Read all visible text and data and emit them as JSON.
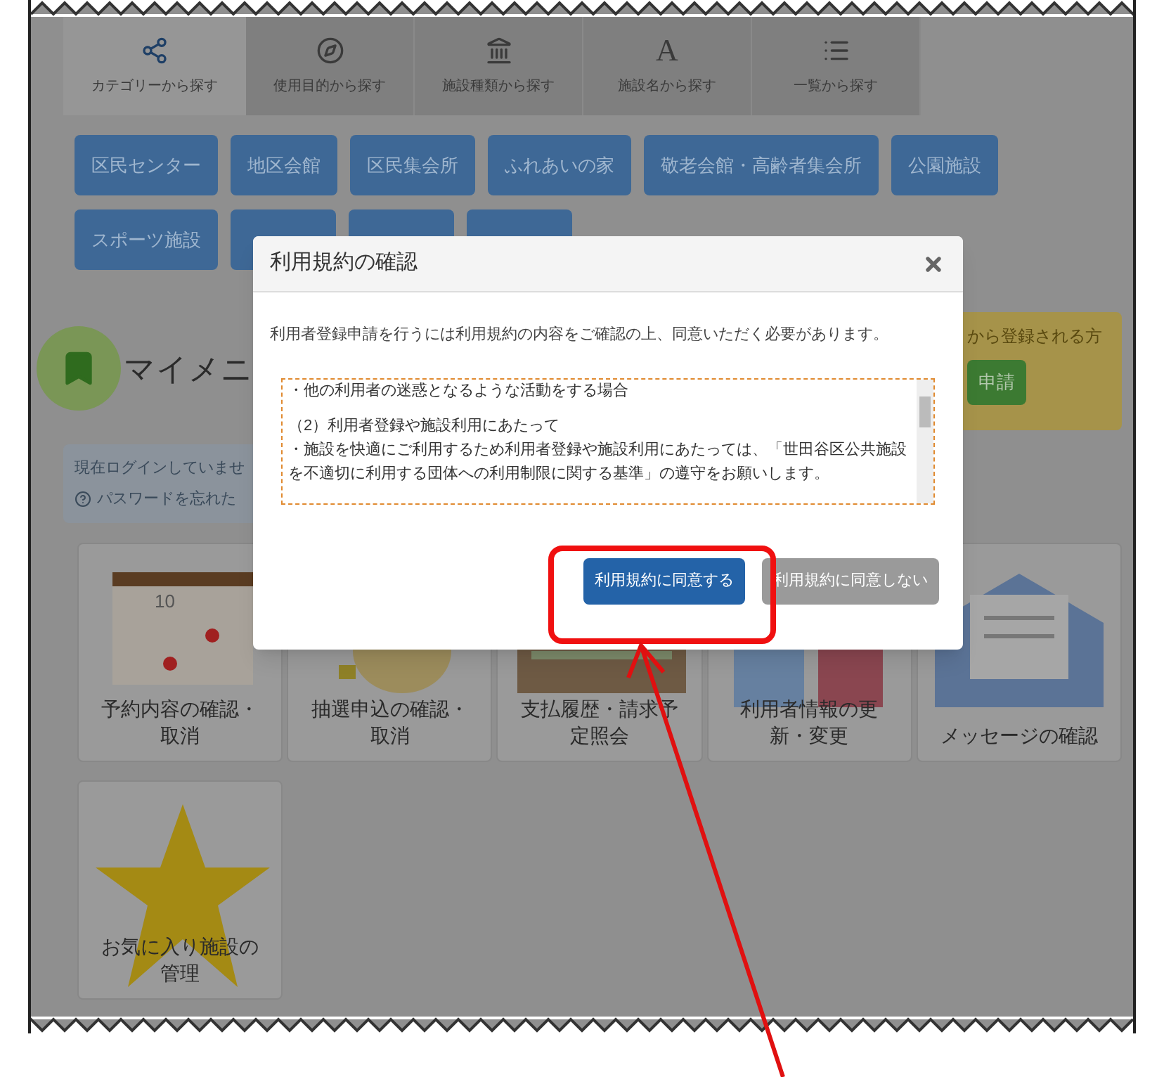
{
  "tabs": [
    {
      "label": "カテゴリーから探す",
      "kind": "share",
      "selected": true
    },
    {
      "label": "使用目的から探す",
      "kind": "compass",
      "selected": false
    },
    {
      "label": "施設種類から探す",
      "kind": "bank",
      "selected": false
    },
    {
      "label": "施設名から探す",
      "kind": "letter",
      "glyph": "A",
      "selected": false
    },
    {
      "label": "一覧から探す",
      "kind": "list",
      "selected": false
    }
  ],
  "categories": [
    {
      "kind": "text",
      "label": "区民センター"
    },
    {
      "kind": "text",
      "label": "地区会館"
    },
    {
      "kind": "text",
      "label": "区民集会所"
    },
    {
      "kind": "text",
      "label": "ふれあいの家"
    },
    {
      "kind": "text",
      "label": "敬老会館・高齢者集会所"
    },
    {
      "kind": "text",
      "label": "公園施設"
    },
    {
      "kind": "text",
      "label": "スポーツ施設"
    },
    {
      "kind": "covered"
    },
    {
      "kind": "covered"
    },
    {
      "kind": "covered"
    }
  ],
  "my_menu": {
    "title": "マイメニ",
    "login_text": "現在ログインしていませ",
    "forgot_link": "パスワードを忘れた"
  },
  "register_box": {
    "text": "から登録される方",
    "button": "申請"
  },
  "tiles": [
    {
      "label": "予約内容の確認・取消",
      "kind": "calendar",
      "art_text": "10"
    },
    {
      "label": "抽選申込の確認・取消",
      "kind": "lottery"
    },
    {
      "label": "支払履歴・請求予定照会",
      "kind": "payment"
    },
    {
      "label": "利用者情報の更新・変更",
      "kind": "people"
    },
    {
      "label": "メッセージの確認",
      "kind": "mail"
    },
    {
      "label": "お気に入り施設の管理",
      "kind": "star"
    }
  ],
  "dialog": {
    "title": "利用規約の確認",
    "message": "利用者登録申請を行うには利用規約の内容をご確認の上、同意いただく必要があります。",
    "terms_paragraphs": [
      [
        "・他の利用者の迷惑となるような活動をする場合"
      ],
      [
        "（2）利用者登録や施設利用にあたって",
        "・施設を快適にご利用するため利用者登録や施設利用にあたっては、「世田谷区公共施設を不適切に利用する団体への利用制限に関する基準」の遵守をお願いします。"
      ]
    ],
    "agree_button": "利用規約に同意する",
    "disagree_button": "利用規約に同意しない"
  }
}
